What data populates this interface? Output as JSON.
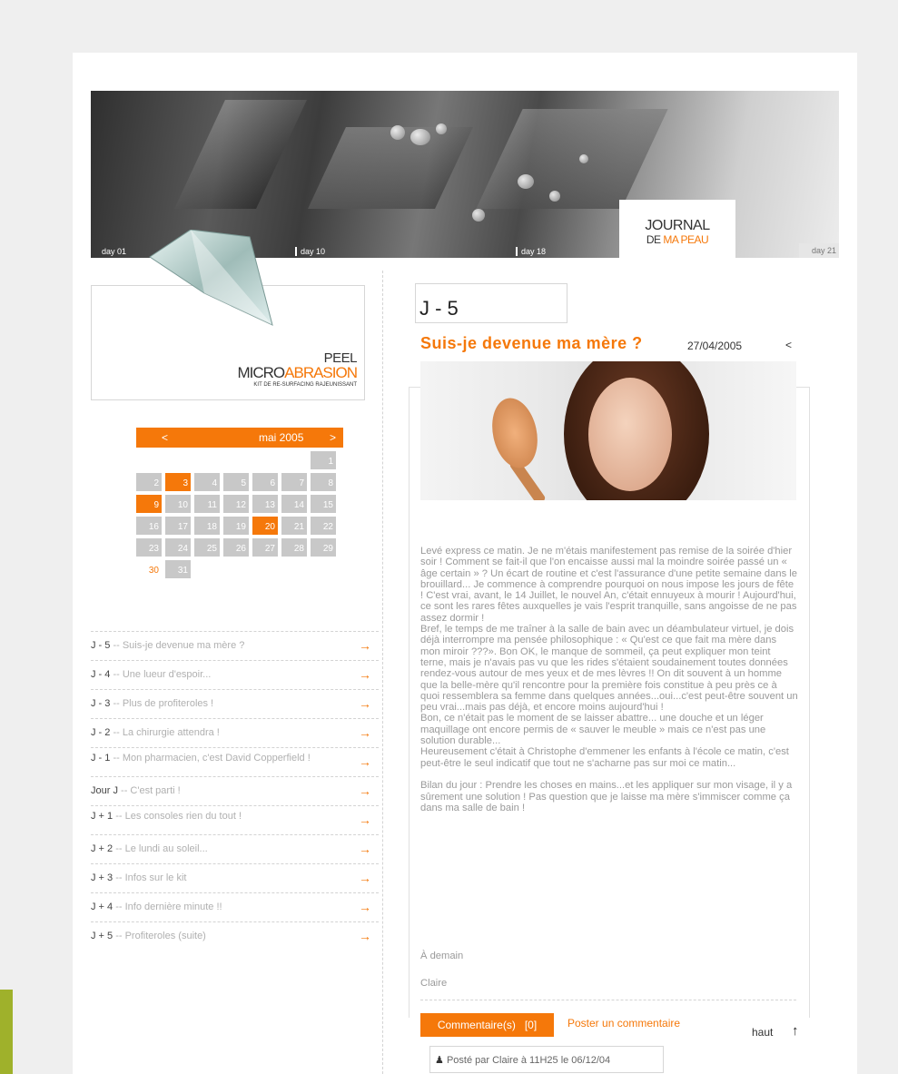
{
  "banner": {
    "days": [
      "day 01",
      "day 10",
      "day 18",
      "day 21"
    ],
    "journal_line1": "JOURNAL",
    "journal_de": "DE ",
    "journal_peau": "MA PEAU"
  },
  "peel": {
    "line1": "PEEL",
    "micro": "MICRO",
    "abrasion": "ABRASION",
    "subtitle": "KIT DE RE-SURFACING RAJEUNISSANT"
  },
  "calendar": {
    "prev": "<",
    "month": "mai 2005",
    "next": ">",
    "days": [
      {
        "n": "",
        "t": "empty"
      },
      {
        "n": "",
        "t": "empty"
      },
      {
        "n": "",
        "t": "empty"
      },
      {
        "n": "",
        "t": "empty"
      },
      {
        "n": "",
        "t": "empty"
      },
      {
        "n": "",
        "t": "empty"
      },
      {
        "n": "1",
        "t": "grey"
      },
      {
        "n": "2",
        "t": "grey"
      },
      {
        "n": "3",
        "t": "hl"
      },
      {
        "n": "4",
        "t": "grey"
      },
      {
        "n": "5",
        "t": "grey"
      },
      {
        "n": "6",
        "t": "grey"
      },
      {
        "n": "7",
        "t": "grey"
      },
      {
        "n": "8",
        "t": "grey"
      },
      {
        "n": "9",
        "t": "hl"
      },
      {
        "n": "10",
        "t": "grey"
      },
      {
        "n": "11",
        "t": "grey"
      },
      {
        "n": "12",
        "t": "grey"
      },
      {
        "n": "13",
        "t": "grey"
      },
      {
        "n": "14",
        "t": "grey"
      },
      {
        "n": "15",
        "t": "grey"
      },
      {
        "n": "16",
        "t": "grey"
      },
      {
        "n": "17",
        "t": "grey"
      },
      {
        "n": "18",
        "t": "grey"
      },
      {
        "n": "19",
        "t": "grey"
      },
      {
        "n": "20",
        "t": "hl"
      },
      {
        "n": "21",
        "t": "grey"
      },
      {
        "n": "22",
        "t": "grey"
      },
      {
        "n": "23",
        "t": "grey"
      },
      {
        "n": "24",
        "t": "grey"
      },
      {
        "n": "25",
        "t": "grey"
      },
      {
        "n": "26",
        "t": "grey"
      },
      {
        "n": "27",
        "t": "grey"
      },
      {
        "n": "28",
        "t": "grey"
      },
      {
        "n": "29",
        "t": "grey"
      },
      {
        "n": "30",
        "t": "plain"
      },
      {
        "n": "31",
        "t": "grey"
      }
    ]
  },
  "entries": [
    {
      "day": "J - 5",
      "title": " -- Suis-je devenue ma mère ?"
    },
    {
      "day": "J - 4",
      "title": " -- Une lueur d'espoir..."
    },
    {
      "day": "J - 3",
      "title": " -- Plus de profiteroles  !"
    },
    {
      "day": "J - 2",
      "title": " -- La chirurgie attendra !"
    },
    {
      "day": "J - 1",
      "title": " -- Mon pharmacien, c'est David Copperfield !"
    },
    {
      "day": "Jour J",
      "title": " -- C'est parti !"
    },
    {
      "day": "J + 1",
      "title": " -- Les consoles rien du tout !"
    },
    {
      "day": "J + 2",
      "title": " -- Le lundi au soleil..."
    },
    {
      "day": "J + 3",
      "title": " -- Infos sur le kit"
    },
    {
      "day": "J + 4",
      "title": " -- Info dernière minute !!"
    },
    {
      "day": "J + 5",
      "title": " -- Profiteroles (suite)"
    }
  ],
  "post": {
    "day_label": "J - 5",
    "title": "Suis-je devenue ma mère ?",
    "date": "27/04/2005",
    "back": "<",
    "body": [
      "Levé express ce matin. Je ne m'étais manifestement pas remise de la soirée d'hier soir ! Comment se fait-il que l'on encaisse aussi mal la moindre soirée passé un « âge certain » ? Un écart de routine et c'est l'assurance d'une petite semaine dans le brouillard... Je commence à comprendre pourquoi on nous impose les jours de fête ! C'est vrai, avant, le 14 Juillet, le nouvel An, c'était ennuyeux à mourir ! Aujourd'hui, ce sont les rares fêtes auxquelles je vais l'esprit tranquille, sans angoisse de ne pas assez dormir !",
      "Bref, le temps de me traîner à la salle de bain avec un déambulateur virtuel, je dois déjà interrompre ma pensée philosophique : « Qu'est ce que fait ma mère dans mon miroir ???». Bon OK, le manque de sommeil, ça peut expliquer mon teint terne, mais je n'avais pas vu que les rides s'étaient soudainement toutes données rendez-vous autour de mes yeux et de mes lèvres !! On dit souvent à un homme que la belle-mère qu'il rencontre pour la première fois constitue à peu près ce à quoi ressemblera sa femme dans quelques années...oui...c'est peut-être souvent un peu vrai...mais pas déjà, et encore moins aujourd'hui !",
      "Bon, ce n'était pas le moment de se laisser abattre... une douche et un léger maquillage ont encore permis de « sauver le meuble » mais ce n'est pas une solution durable...",
      "Heureusement c'était à Christophe d'emmener les enfants à l'école ce matin, c'est peut-être le seul indicatif que tout ne s'acharne pas sur moi ce matin...",
      "",
      "Bilan du jour : Prendre les choses en mains...et les appliquer sur mon visage, il y a sûrement une solution ! Pas question que je laisse ma mère s'immiscer comme ça dans ma salle de bain !"
    ],
    "closing": "À demain",
    "signature": "Claire",
    "comments_label": "Commentaire(s)",
    "comments_count": "[0]",
    "post_comment": "Poster un commentaire",
    "top": "haut",
    "posted_by": "Posté par Claire à 11H25 le 06/12/04"
  },
  "colors": {
    "accent": "#f5780a",
    "grey_cell": "#c8c8c8",
    "green": "#9fb12b"
  }
}
